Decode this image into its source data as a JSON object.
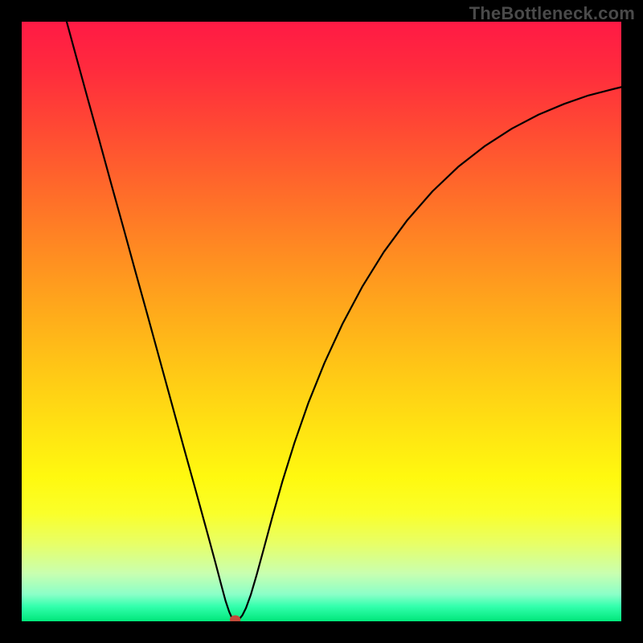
{
  "watermark": "TheBottleneck.com",
  "chart_data": {
    "type": "line",
    "title": "",
    "xlabel": "",
    "ylabel": "",
    "xlim": [
      0,
      1
    ],
    "ylim": [
      0,
      1
    ],
    "series": [
      {
        "name": "curve",
        "points": [
          {
            "x": 0.075,
            "y": 1.0
          },
          {
            "x": 0.09,
            "y": 0.945
          },
          {
            "x": 0.11,
            "y": 0.872
          },
          {
            "x": 0.13,
            "y": 0.8
          },
          {
            "x": 0.15,
            "y": 0.727
          },
          {
            "x": 0.17,
            "y": 0.655
          },
          {
            "x": 0.19,
            "y": 0.582
          },
          {
            "x": 0.21,
            "y": 0.51
          },
          {
            "x": 0.23,
            "y": 0.437
          },
          {
            "x": 0.25,
            "y": 0.364
          },
          {
            "x": 0.27,
            "y": 0.291
          },
          {
            "x": 0.29,
            "y": 0.219
          },
          {
            "x": 0.31,
            "y": 0.146
          },
          {
            "x": 0.323,
            "y": 0.098
          },
          {
            "x": 0.333,
            "y": 0.06
          },
          {
            "x": 0.34,
            "y": 0.034
          },
          {
            "x": 0.346,
            "y": 0.016
          },
          {
            "x": 0.35,
            "y": 0.007
          },
          {
            "x": 0.354,
            "y": 0.003
          },
          {
            "x": 0.358,
            "y": 0.003
          },
          {
            "x": 0.363,
            "y": 0.004
          },
          {
            "x": 0.368,
            "y": 0.01
          },
          {
            "x": 0.374,
            "y": 0.022
          },
          {
            "x": 0.382,
            "y": 0.044
          },
          {
            "x": 0.392,
            "y": 0.078
          },
          {
            "x": 0.404,
            "y": 0.122
          },
          {
            "x": 0.418,
            "y": 0.174
          },
          {
            "x": 0.435,
            "y": 0.234
          },
          {
            "x": 0.455,
            "y": 0.298
          },
          {
            "x": 0.478,
            "y": 0.364
          },
          {
            "x": 0.505,
            "y": 0.431
          },
          {
            "x": 0.535,
            "y": 0.496
          },
          {
            "x": 0.568,
            "y": 0.558
          },
          {
            "x": 0.604,
            "y": 0.616
          },
          {
            "x": 0.643,
            "y": 0.669
          },
          {
            "x": 0.685,
            "y": 0.717
          },
          {
            "x": 0.728,
            "y": 0.758
          },
          {
            "x": 0.773,
            "y": 0.793
          },
          {
            "x": 0.818,
            "y": 0.822
          },
          {
            "x": 0.862,
            "y": 0.845
          },
          {
            "x": 0.905,
            "y": 0.863
          },
          {
            "x": 0.945,
            "y": 0.877
          },
          {
            "x": 0.98,
            "y": 0.886
          },
          {
            "x": 1.0,
            "y": 0.891
          }
        ]
      }
    ],
    "marker": {
      "x": 0.356,
      "y": 0.003,
      "rx": 0.009,
      "ry": 0.007
    }
  },
  "colors": {
    "curve": "#000000",
    "marker": "#c24a3a",
    "frame": "#000000"
  }
}
